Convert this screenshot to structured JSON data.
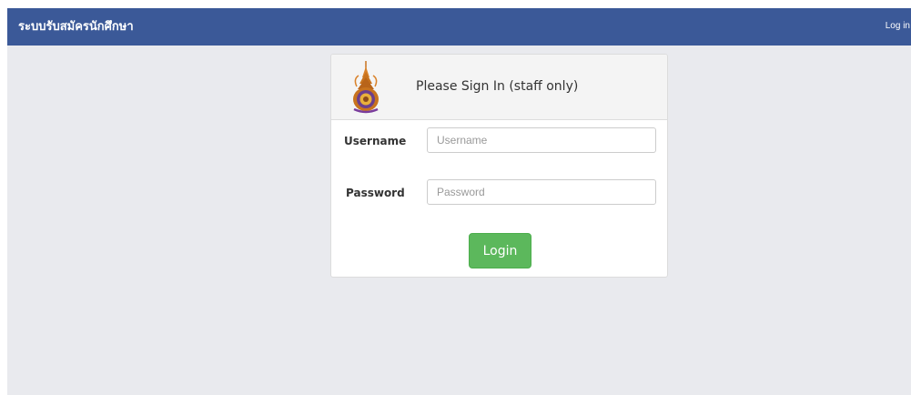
{
  "navbar": {
    "brand": "ระบบรับสมัครนักศึกษา",
    "login_link": "Log in",
    "background": "#3b5998"
  },
  "login_card": {
    "title": "Please Sign In (staff only)",
    "logo_icon": "university-emblem-icon",
    "username": {
      "label": "Username",
      "placeholder": "Username",
      "value": ""
    },
    "password": {
      "label": "Password",
      "placeholder": "Password",
      "value": ""
    },
    "submit_label": "Login",
    "submit_color": "#5cb85c"
  },
  "page_background": "#e9eaee"
}
